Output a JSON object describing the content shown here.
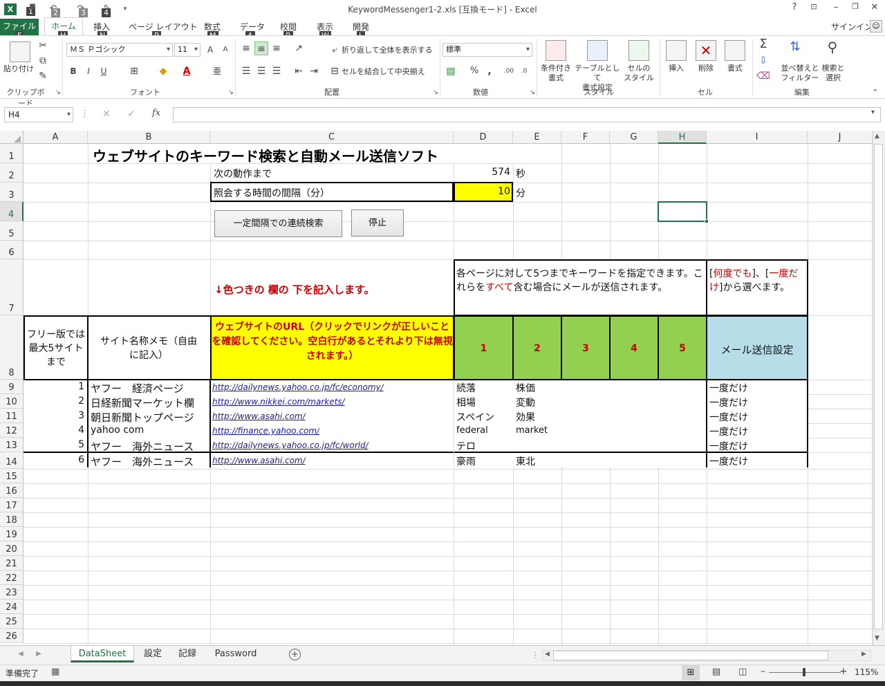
{
  "window": {
    "title": "KeywordMessenger1-2.xls  [互換モード] - Excel",
    "help": "?",
    "signin": "サインイン"
  },
  "qat_keytips": [
    "1",
    "2",
    "3",
    "4"
  ],
  "ribbon_tabs": [
    {
      "label": "ファイル",
      "keytip": "F"
    },
    {
      "label": "ホーム",
      "keytip": "H"
    },
    {
      "label": "挿入",
      "keytip": "N"
    },
    {
      "label": "ページ レイアウト",
      "keytip": "P"
    },
    {
      "label": "数式",
      "keytip": "M"
    },
    {
      "label": "データ",
      "keytip": "A"
    },
    {
      "label": "校閲",
      "keytip": "R"
    },
    {
      "label": "表示",
      "keytip": "W"
    },
    {
      "label": "開発",
      "keytip": "L"
    }
  ],
  "ribbon": {
    "clipboard": {
      "label": "クリップボード",
      "paste": "貼り付け"
    },
    "font": {
      "label": "フォント",
      "name": "ＭＳ Ｐゴシック",
      "size": "11",
      "bold": "B",
      "italic": "I",
      "underline": "U"
    },
    "align": {
      "label": "配置",
      "wrap": "折り返して全体を表示する",
      "merge": "セルを結合して中央揃え"
    },
    "number": {
      "label": "数値",
      "format": "標準",
      "percent": "%",
      "comma": ","
    },
    "styles": {
      "label": "スタイル",
      "cond1": "条件付き",
      "cond2": "書式",
      "table1": "テーブルとして",
      "table2": "書式設定",
      "cell1": "セルの",
      "cell2": "スタイル"
    },
    "cells": {
      "label": "セル",
      "insert": "挿入",
      "delete": "削除",
      "format": "書式"
    },
    "edit": {
      "label": "編集",
      "sort1": "並べ替えと",
      "sort2": "フィルター",
      "find1": "検索と",
      "find2": "選択"
    }
  },
  "formula_bar": {
    "name_box": "H4",
    "fx": "fx",
    "value": ""
  },
  "columns": [
    "A",
    "B",
    "C",
    "D",
    "E",
    "F",
    "G",
    "H",
    "I",
    "J"
  ],
  "rows": [
    "1",
    "2",
    "3",
    "4",
    "5",
    "6",
    "7",
    "8",
    "9",
    "10",
    "11",
    "12",
    "13",
    "14",
    "15",
    "16",
    "17",
    "18",
    "19",
    "20",
    "21",
    "22",
    "23",
    "24",
    "25",
    "26"
  ],
  "sheet": {
    "title": "ウェブサイトのキーワード検索と自動メール送信ソフト",
    "next_action_label": "次の動作まで",
    "next_action_value": "574",
    "next_action_unit": "秒",
    "interval_label": "照会する時間の間隔（分）",
    "interval_value": "10",
    "interval_unit": "分",
    "btn_continuous": "一定間隔での連続検索",
    "btn_stop": "停止",
    "note_arrow": "↓色つきの 欄の 下を記入します。",
    "note_keywords": {
      "part1": "各ページに対して5つまでキーワードを指定できます。これらを",
      "part2": "すべて",
      "part3": "含む場合にメールが送信されます。"
    },
    "note_mail": {
      "p1": "[",
      "p2": "何度でも",
      "p3": "]、[",
      "p4": "一度だけ",
      "p5": "]から選べます。"
    },
    "hdr_free": "フリー版では最大5サイトまで",
    "hdr_site": "サイト名称メモ（自由に記入）",
    "hdr_url": "ウェブサイトのURL（クリックでリンクが正しいことを確認してください。空白行があるとそれより下は無視されます。）",
    "hdr_kw": [
      "1",
      "2",
      "3",
      "4",
      "5"
    ],
    "hdr_mail": "メール送信設定",
    "records": [
      {
        "no": "1",
        "site": "ヤフー　経済ページ",
        "url": "http://dailynews.yahoo.co.jp/fc/economy/",
        "kw1": "続落",
        "kw2": "株価",
        "mail": "一度だけ"
      },
      {
        "no": "2",
        "site": "日経新聞マーケット欄",
        "url": "http://www.nikkei.com/markets/",
        "kw1": "相場",
        "kw2": "変動",
        "mail": "一度だけ"
      },
      {
        "no": "3",
        "site": "朝日新聞トップページ",
        "url": "http://www.asahi.com/",
        "kw1": "スペイン",
        "kw2": "効果",
        "mail": "一度だけ"
      },
      {
        "no": "4",
        "site": "yahoo com",
        "url": "http://finance.yahoo.com/",
        "kw1": "federal",
        "kw2": "market",
        "mail": "一度だけ"
      },
      {
        "no": "5",
        "site": "ヤフー　海外ニュース",
        "url": "http://dailynews.yahoo.co.jp/fc/world/",
        "kw1": "テロ",
        "kw2": "",
        "mail": "一度だけ"
      },
      {
        "no": "6",
        "site": "ヤフー　海外ニュース",
        "url": "http://www.asahi.com/",
        "kw1": "豪雨",
        "kw2": "東北",
        "mail": "一度だけ"
      }
    ]
  },
  "sheet_tabs": [
    "DataSheet",
    "設定",
    "記録",
    "Password"
  ],
  "status": {
    "ready": "準備完了",
    "zoom": "115%"
  },
  "colors": {
    "excel_green": "#217346",
    "yellow": "#ffff00",
    "green": "#92d050",
    "blue": "#b7dde8",
    "red": "#cc0000"
  }
}
